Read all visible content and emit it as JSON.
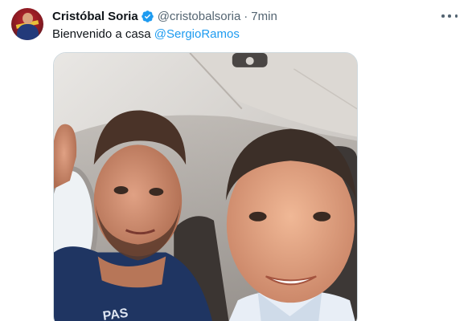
{
  "tweet": {
    "author": {
      "display_name": "Cristóbal Soria",
      "handle": "@cristobalsoria",
      "verified": true,
      "verified_color": "#1d9bf0",
      "avatar_icon": "avatar-image"
    },
    "separator": "·",
    "timestamp": "7min",
    "text_prefix": "Bienvenido a casa ",
    "mention": "@SergioRamos",
    "mention_color": "#1d9bf0",
    "more_icon": "more-options-icon",
    "media": {
      "type": "photo",
      "jersey_text": "PAS"
    }
  }
}
